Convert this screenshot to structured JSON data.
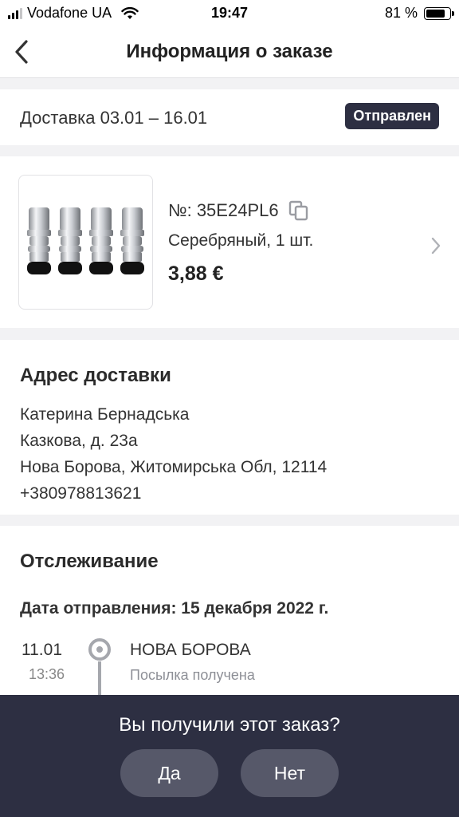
{
  "status_bar": {
    "carrier": "Vodafone UA",
    "time": "19:47",
    "battery": "81 %",
    "battery_level": 0.81
  },
  "nav": {
    "title": "Информация о заказе",
    "back_icon": "chevron-left-icon"
  },
  "delivery": {
    "text": "Доставка 03.01 – 16.01",
    "status": "Отправлен",
    "status_color": "#2d2f42"
  },
  "product": {
    "number": "№: 35E24PL6",
    "variant": "Серебряный, 1 шт.",
    "price": "3,88 €",
    "image_icon": "valve-caps-image",
    "copy_icon": "copy-icon",
    "arrow_icon": "chevron-right-icon"
  },
  "address": {
    "title": "Адрес доставки",
    "name": "Катерина Бернадська",
    "street": "Казкова, д. 23а",
    "city": "Нова Борова, Житомирська Обл, 12114",
    "phone": "+380978813621"
  },
  "tracking": {
    "title": "Отслеживание",
    "ship_date": "Дата отправления: 15 декабря 2022 г.",
    "events": [
      {
        "date": "11.01",
        "time": "13:36",
        "place": "НОВА БОРОВА",
        "status": "Посылка получена"
      }
    ]
  },
  "prompt": {
    "question": "Вы получили этот заказ?",
    "yes": "Да",
    "no": "Нет",
    "background": "#2d2f42"
  }
}
